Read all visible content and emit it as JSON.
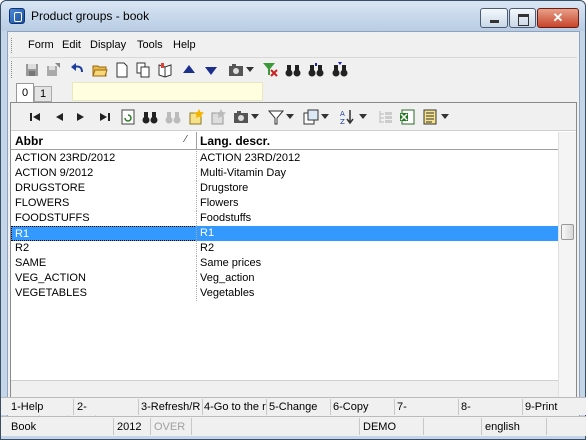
{
  "window": {
    "title": "Product groups - book"
  },
  "menu": [
    "Form",
    "Edit",
    "Display",
    "Tools",
    "Help"
  ],
  "tabs": [
    "0",
    "1"
  ],
  "grid": {
    "columns": [
      "Abbr",
      "Lang. descr."
    ],
    "rows": [
      [
        "ACTION 23RD/2012",
        "ACTION 23RD/2012"
      ],
      [
        "ACTION 9/2012",
        "Multi-Vitamin Day"
      ],
      [
        "DRUGSTORE",
        "Drugstore"
      ],
      [
        "FLOWERS",
        "Flowers"
      ],
      [
        "FOODSTUFFS",
        "Foodstuffs"
      ],
      [
        "R1",
        "R1"
      ],
      [
        "R2",
        "R2"
      ],
      [
        "SAME",
        "Same prices"
      ],
      [
        "VEG_ACTION",
        "Veg_action"
      ],
      [
        "VEGETABLES",
        "Vegetables"
      ]
    ],
    "selected_row": 5
  },
  "function_keys": [
    "1-Help",
    "2-",
    "3-Refresh/R",
    "4-Go to the r",
    "5-Change",
    "6-Copy",
    "7-",
    "8-",
    "9-Print"
  ],
  "status": {
    "book": "Book",
    "year": "2012",
    "mode": "OVER",
    "db": "DEMO",
    "lang": "english"
  },
  "colors": {
    "selection": "#3399ff",
    "titlebar": "#c4d5e8",
    "close": "#c7442a"
  }
}
